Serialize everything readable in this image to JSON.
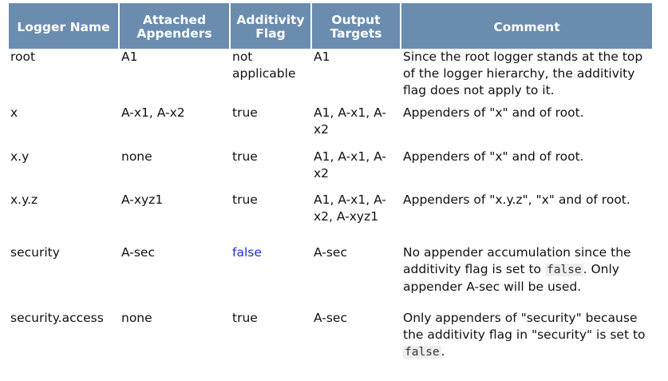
{
  "headers": {
    "logger_name": "Logger Name",
    "attached_appenders": "Attached Appenders",
    "additivity_flag": "Additivity Flag",
    "output_targets": "Output Targets",
    "comment": "Comment"
  },
  "rows": [
    {
      "logger": "root",
      "appenders": "A1",
      "flag": "not applicable",
      "targets": "A1",
      "comment": "Since the root logger stands at the top of the logger hierarchy, the additivity flag does not apply to it."
    },
    {
      "logger": "x",
      "appenders": "A-x1, A-x2",
      "flag": "true",
      "targets": "A1, A-x1, A-x2",
      "comment": "Appenders of \"x\" and of root."
    },
    {
      "logger": "x.y",
      "appenders": "none",
      "flag": "true",
      "targets": "A1, A-x1, A-x2",
      "comment": "Appenders of \"x\" and of root."
    },
    {
      "logger": "x.y.z",
      "appenders": "A-xyz1",
      "flag": "true",
      "targets": "A1, A-x1, A-x2, A-xyz1",
      "comment": "Appenders of \"x.y.z\", \"x\" and of root."
    },
    {
      "logger": "security",
      "appenders": "A-sec",
      "flag": "false",
      "targets": "A-sec",
      "comment_before": "No appender accumulation since the additivity flag is set to ",
      "comment_code": "false",
      "comment_after": ". Only appender A-sec will be used."
    },
    {
      "logger": "security.access",
      "appenders": "none",
      "flag": "true",
      "targets": "A-sec",
      "comment_before": "Only appenders of \"security\" because the additivity flag in \"security\" is set to ",
      "comment_code": "false",
      "comment_after": "."
    }
  ],
  "colors": {
    "header_bg": "#6a8caf",
    "false_flag": "#1a33c8"
  }
}
